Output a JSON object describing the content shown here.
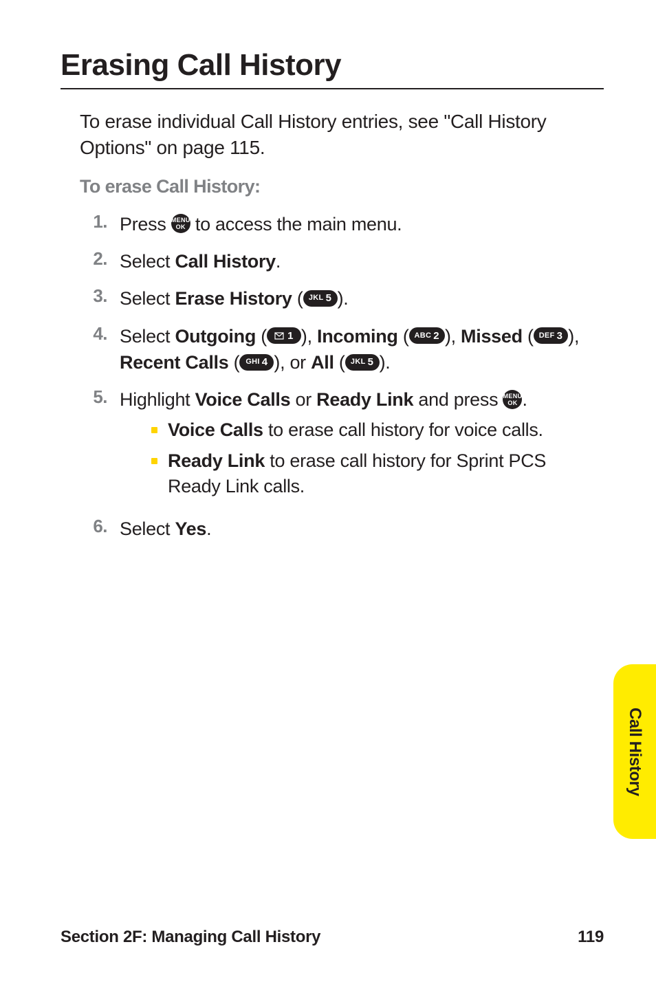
{
  "title": "Erasing Call History",
  "intro": "To erase individual Call History entries, see \"Call History Options\" on page 115.",
  "subhead": "To erase Call History:",
  "icons": {
    "menu_ok_l1": "MENU",
    "menu_ok_l2": "OK",
    "jkl5_small": "JKL",
    "jkl5_big": "5",
    "msg1_big": "1",
    "abc2_small": "ABC",
    "abc2_big": "2",
    "def3_small": "DEF",
    "def3_big": "3",
    "ghi4_small": "GHI",
    "ghi4_big": "4"
  },
  "steps": {
    "s1_a": "Press ",
    "s1_b": " to access the main menu.",
    "s2_a": "Select ",
    "s2_b": "Call History",
    "s2_c": ".",
    "s3_a": "Select ",
    "s3_b": "Erase History",
    "s3_c": " (",
    "s3_d": ").",
    "s4_a": "Select ",
    "s4_b": "Outgoing",
    "s4_c": " (",
    "s4_d": "), ",
    "s4_e": "Incoming",
    "s4_f": " (",
    "s4_g": "), ",
    "s4_h": "Missed",
    "s4_i": " (",
    "s4_j": "), ",
    "s4_k": "Recent Calls",
    "s4_l": " (",
    "s4_m": "), or ",
    "s4_n": "All",
    "s4_o": " (",
    "s4_p": ").",
    "s5_a": "Highlight ",
    "s5_b": "Voice Calls",
    "s5_c": " or ",
    "s5_d": "Ready Link",
    "s5_e": " and press ",
    "s5_f": ".",
    "s5_sub1_a": "Voice Calls",
    "s5_sub1_b": " to erase call history for voice calls.",
    "s5_sub2_a": "Ready Link",
    "s5_sub2_b": " to erase call history for Sprint PCS Ready Link calls.",
    "s6_a": "Select ",
    "s6_b": "Yes",
    "s6_c": "."
  },
  "nums": {
    "n1": "1.",
    "n2": "2.",
    "n3": "3.",
    "n4": "4.",
    "n5": "5.",
    "n6": "6."
  },
  "sidetab": "Call History",
  "footer": {
    "left": "Section 2F: Managing Call History",
    "right": "119"
  }
}
